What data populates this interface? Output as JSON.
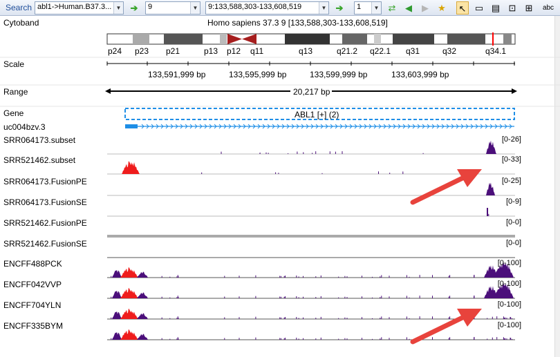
{
  "toolbar": {
    "search_label": "Search",
    "genome_combo": "abl1->Human.B37.3...",
    "chrom_combo": "9",
    "locus_input": "9:133,588,303-133,608,519",
    "frame_combo": "1"
  },
  "cytoband": {
    "label": "Cytoband",
    "title": "Homo sapiens 37.3 9 [133,588,303-133,608,519]",
    "bands": [
      "p24",
      "p23",
      "p21",
      "p13",
      "p12",
      "q11",
      "q13",
      "q21.2",
      "q22.1",
      "q31",
      "q32",
      "q34.1"
    ]
  },
  "scale": {
    "label": "Scale",
    "ticks": [
      "133,591,999 bp",
      "133,595,999 bp",
      "133,599,999 bp",
      "133,603,999 bp"
    ]
  },
  "range": {
    "label": "Range",
    "value": "20,217 bp"
  },
  "gene": {
    "label": "Gene",
    "feature": "ABL1 [+] (2)"
  },
  "transcript": {
    "label": "uc004bzv.3"
  },
  "tracks": [
    {
      "name": "SRR064173.subset",
      "range": "[0-26]"
    },
    {
      "name": "SRR521462.subset",
      "range": "[0-33]"
    },
    {
      "name": "SRR064173.FusionPE",
      "range": "[0-25]"
    },
    {
      "name": "SRR064173.FusionSE",
      "range": "[0-9]"
    },
    {
      "name": "SRR521462.FusionPE",
      "range": "[0-0]"
    },
    {
      "name": "SRR521462.FusionSE",
      "range": "[0-0]"
    },
    {
      "name": "ENCFF488PCK",
      "range": "[0-100]"
    },
    {
      "name": "ENCFF042VVP",
      "range": "[0-100]"
    },
    {
      "name": "ENCFF704YLN",
      "range": "[0-100]"
    },
    {
      "name": "ENCFF335BYM",
      "range": "[0-100]"
    }
  ],
  "colors": {
    "coverage_purple": "#4b0f7a",
    "coverage_red": "#ef1c1c",
    "gene_blue": "#1e8ee6",
    "arrow_red": "#e8433c"
  }
}
